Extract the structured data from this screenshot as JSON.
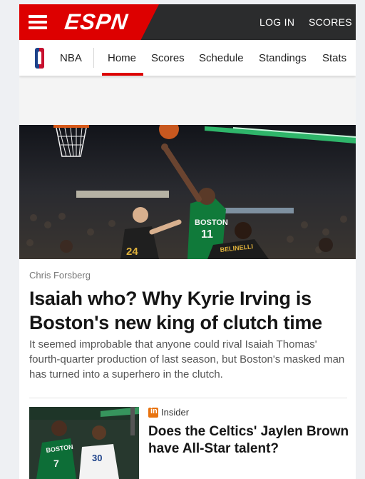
{
  "header": {
    "logo_text": "ESPN",
    "login_label": "LOG IN",
    "scores_label": "SCORES"
  },
  "subnav": {
    "league": "NBA",
    "items": [
      {
        "label": "Home",
        "active": true
      },
      {
        "label": "Scores"
      },
      {
        "label": "Schedule"
      },
      {
        "label": "Standings"
      },
      {
        "label": "Stats"
      }
    ]
  },
  "hero": {
    "jersey_home": "BOSTON",
    "jersey_home_number": "11",
    "jersey_away_number": "24",
    "jersey_away_name": "BELINELLI"
  },
  "article": {
    "author": "Chris Forsberg",
    "headline": "Isaiah who? Why Kyrie Irving is Boston's new king of clutch time",
    "summary": "It seemed improbable that anyone could rival Isaiah Thomas' fourth-quarter production of last season, but Boston's masked man has turned into a superhero in the clutch."
  },
  "story2": {
    "badge": "Insider",
    "headline": "Does the Celtics' Jaylen Brown have All-Star talent?",
    "thumb_jersey_left": "BOSTON",
    "thumb_number_left": "7",
    "thumb_number_right": "30"
  },
  "colors": {
    "espn_red": "#dd0000",
    "header_dark": "#2b2c2d",
    "insider_orange": "#e8730f"
  }
}
